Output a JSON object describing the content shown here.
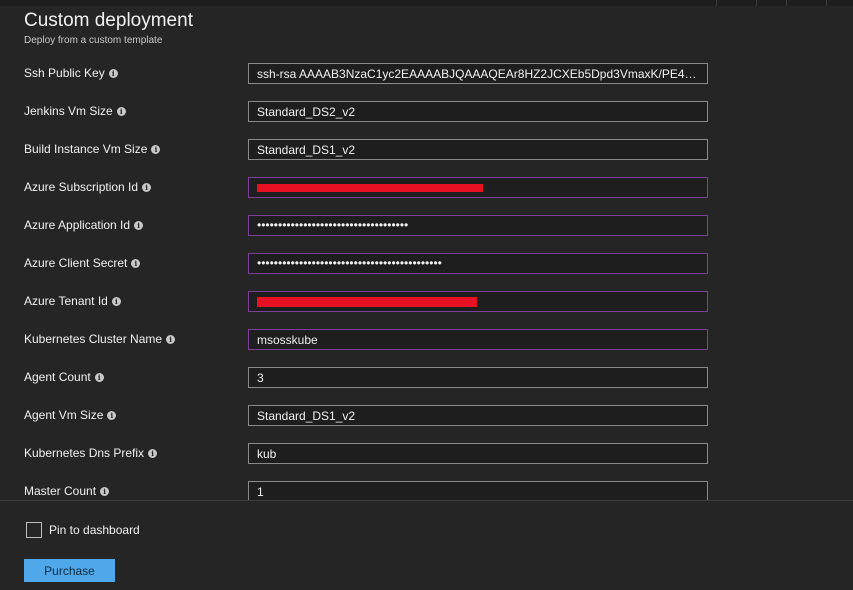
{
  "blade": {
    "title": "Custom deployment",
    "subtitle": "Deploy from a custom template"
  },
  "fields": [
    {
      "label": "Ssh Public Key",
      "value": "ssh-rsa AAAAB3NzaC1yc2EAAAABJQAAAQEAr8HZ2JCXEb5Dpd3VmaxK/PE4/nu6m...",
      "type": "text"
    },
    {
      "label": "Jenkins Vm Size",
      "value": "Standard_DS2_v2",
      "type": "text"
    },
    {
      "label": "Build Instance Vm Size",
      "value": "Standard_DS1_v2",
      "type": "text"
    },
    {
      "label": "Azure Subscription Id",
      "value": "",
      "type": "redacted"
    },
    {
      "label": "Azure Application Id",
      "value": "••••••••••••••••••••••••••••••••••••",
      "type": "password"
    },
    {
      "label": "Azure Client Secret",
      "value": "••••••••••••••••••••••••••••••••••••••••••••",
      "type": "password"
    },
    {
      "label": "Azure Tenant Id",
      "value": "",
      "type": "redacted"
    },
    {
      "label": "Kubernetes Cluster Name",
      "value": "msosskube",
      "type": "text"
    },
    {
      "label": "Agent Count",
      "value": "3",
      "type": "text"
    },
    {
      "label": "Agent Vm Size",
      "value": "Standard_DS1_v2",
      "type": "text"
    },
    {
      "label": "Kubernetes Dns Prefix",
      "value": "kub",
      "type": "text"
    },
    {
      "label": "Master Count",
      "value": "1",
      "type": "text"
    }
  ],
  "footer": {
    "pin_label": "Pin to dashboard",
    "pin_checked": false,
    "purchase_label": "Purchase"
  },
  "colors": {
    "accent": "#4ea8ea",
    "focus_border": "#7d3f98",
    "redaction": "#e81123"
  },
  "icons": {
    "info": "info-icon"
  }
}
